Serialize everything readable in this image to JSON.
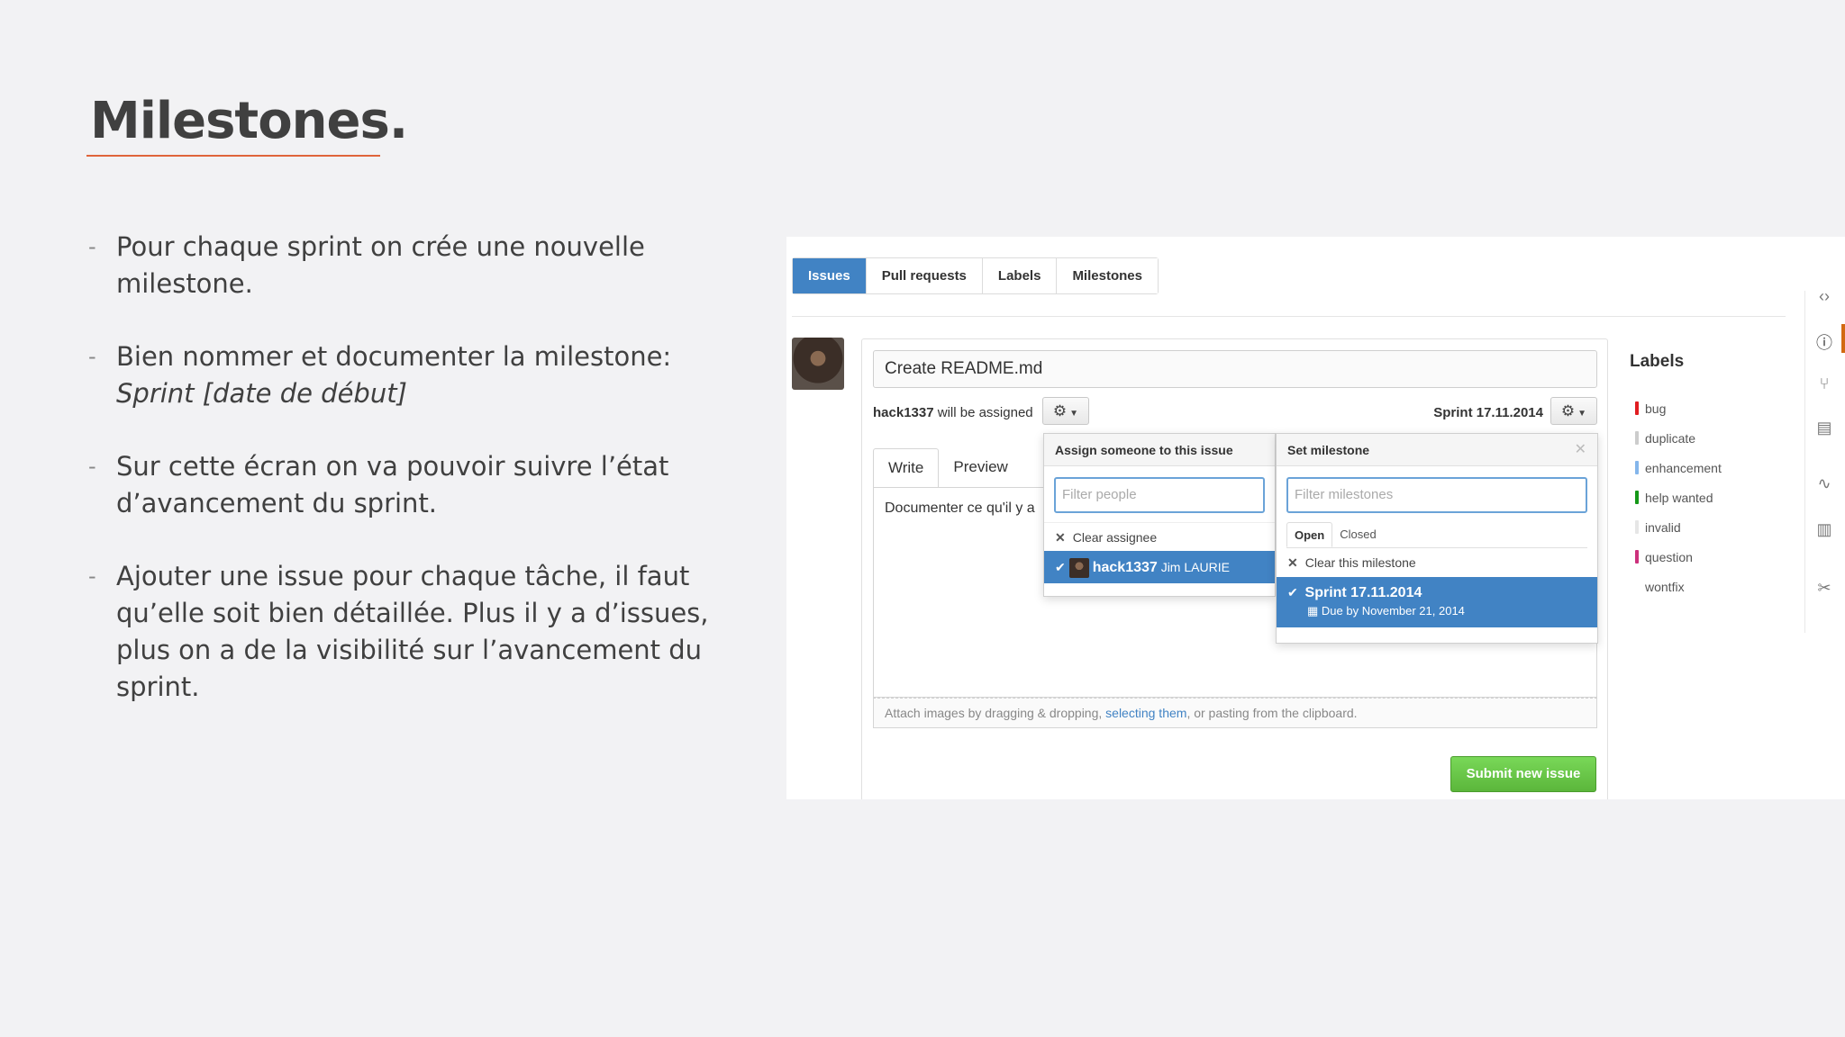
{
  "slide": {
    "title": "Milestones.",
    "bullets": [
      {
        "text": "Pour chaque sprint on crée une nouvelle milestone.",
        "italic": ""
      },
      {
        "text": "Bien nommer et documenter la milestone:",
        "italic": "Sprint [date de début]"
      },
      {
        "text": "Sur cette écran on va pouvoir suivre l’état d’avancement du sprint.",
        "italic": ""
      },
      {
        "text": "Ajouter une issue pour chaque tâche, il faut qu’elle soit bien détaillée. Plus il y a d’issues, plus on a de la visibilité sur l’avancement du sprint.",
        "italic": ""
      }
    ],
    "accent_color": "#e0643a"
  },
  "screenshot": {
    "tabs": [
      "Issues",
      "Pull requests",
      "Labels",
      "Milestones"
    ],
    "issue_title": "Create README.md",
    "assign_user": "hack1337",
    "assign_suffix": " will be assigned",
    "milestone_label": "Sprint 17.11.2014",
    "editor_tabs": {
      "write": "Write",
      "preview": "Preview"
    },
    "editor_text": "Documenter ce qu'il y a",
    "attach": {
      "before": "Attach images by dragging & dropping, ",
      "link": "selecting them",
      "after": ", or pasting from the clipboard."
    },
    "submit_label": "Submit new issue",
    "assign_dropdown": {
      "header": "Assign someone to this issue",
      "filter_placeholder": "Filter people",
      "clear_label": "Clear assignee",
      "selected_user": "hack1337",
      "selected_name": "Jim LAURIE"
    },
    "milestone_dropdown": {
      "header": "Set milestone",
      "filter_placeholder": "Filter milestones",
      "tab_open": "Open",
      "tab_closed": "Closed",
      "clear_label": "Clear this milestone",
      "selected_title": "Sprint 17.11.2014",
      "selected_due": "Due by November 21, 2014"
    },
    "labels_title": "Labels",
    "labels": [
      {
        "name": "bug",
        "color": "#e11d21"
      },
      {
        "name": "duplicate",
        "color": "#cccccc"
      },
      {
        "name": "enhancement",
        "color": "#84b6eb"
      },
      {
        "name": "help wanted",
        "color": "#159818"
      },
      {
        "name": "invalid",
        "color": "#e6e6e6"
      },
      {
        "name": "question",
        "color": "#cc317c"
      },
      {
        "name": "wontfix",
        "color": "#ffffff"
      }
    ],
    "brand_blue": "#4183c4",
    "submit_green": "#5bb63b",
    "side_icons": [
      "code-icon",
      "issue-icon",
      "pull-request-icon",
      "wiki-icon",
      "pulse-icon",
      "graph-icon",
      "settings-icon"
    ]
  }
}
